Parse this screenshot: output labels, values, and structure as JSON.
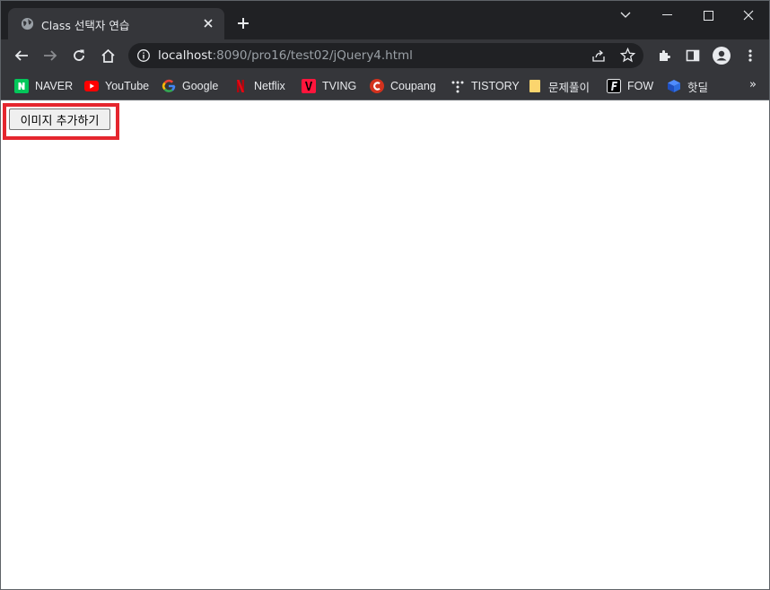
{
  "tab": {
    "title": "Class 선택자 연습"
  },
  "address_bar": {
    "host": "localhost",
    "path": ":8090/pro16/test02/jQuery4.html"
  },
  "bookmarks": [
    {
      "label": "NAVER",
      "icon": "naver-icon"
    },
    {
      "label": "YouTube",
      "icon": "youtube-icon"
    },
    {
      "label": "Google",
      "icon": "google-icon"
    },
    {
      "label": "Netflix",
      "icon": "netflix-icon"
    },
    {
      "label": "TVING",
      "icon": "tving-icon"
    },
    {
      "label": "Coupang",
      "icon": "coupang-icon"
    },
    {
      "label": "TISTORY",
      "icon": "tistory-icon"
    },
    {
      "label": "문제풀이",
      "icon": "folder-icon"
    },
    {
      "label": "FOW",
      "icon": "fow-icon"
    },
    {
      "label": "핫딜",
      "icon": "hotdeal-icon"
    }
  ],
  "bookmarks_overflow": "»",
  "page": {
    "add_image_button": "이미지 추가하기"
  },
  "colors": {
    "highlight": "#e5262e",
    "chrome_dark": "#202124",
    "chrome_toolbar": "#35363a"
  }
}
